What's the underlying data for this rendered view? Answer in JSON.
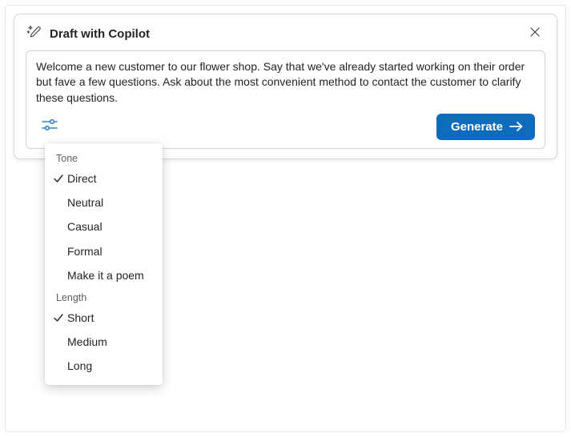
{
  "header": {
    "title": "Draft with Copilot"
  },
  "prompt": {
    "text": "Welcome a new customer to our flower shop. Say that we've already started working on their order but fave a few questions. Ask about the most convenient method to contact the customer to clarify these questions."
  },
  "generate_label": "Generate",
  "dropdown": {
    "sections": [
      {
        "label": "Tone",
        "items": [
          {
            "label": "Direct",
            "selected": true
          },
          {
            "label": "Neutral",
            "selected": false
          },
          {
            "label": "Casual",
            "selected": false
          },
          {
            "label": "Formal",
            "selected": false
          },
          {
            "label": "Make it a poem",
            "selected": false
          }
        ]
      },
      {
        "label": "Length",
        "items": [
          {
            "label": "Short",
            "selected": true
          },
          {
            "label": "Medium",
            "selected": false
          },
          {
            "label": "Long",
            "selected": false
          }
        ]
      }
    ]
  }
}
